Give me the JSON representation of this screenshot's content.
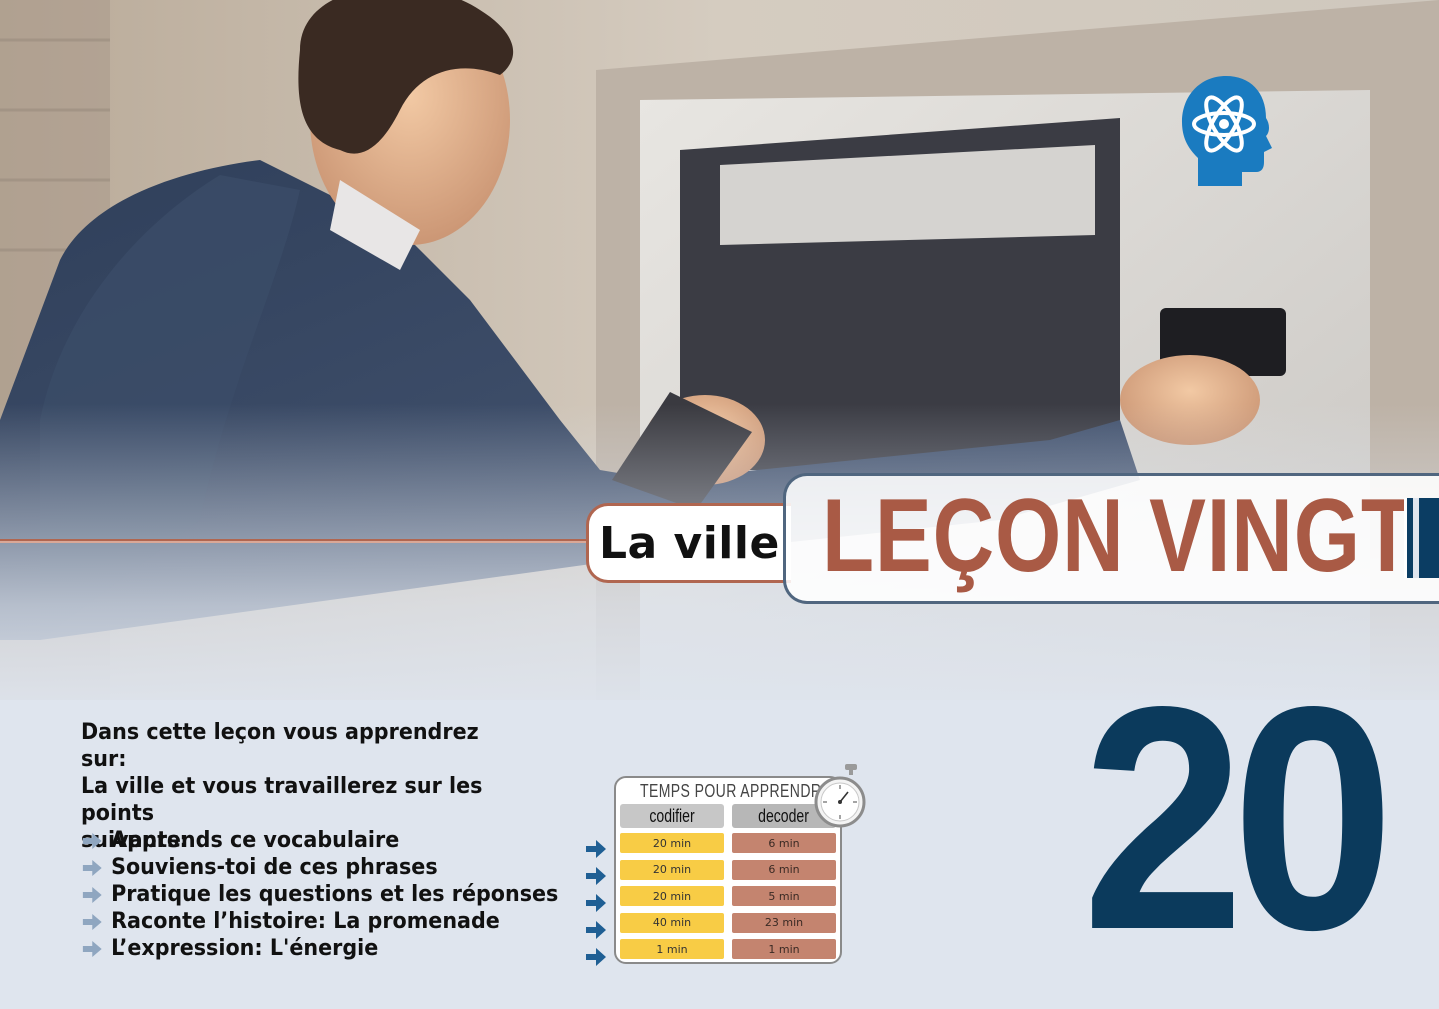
{
  "header": {
    "subtitle": "La ville",
    "title": "LEÇON VINGT"
  },
  "intro": {
    "line1": "Dans cette leçon vous apprendrez sur:",
    "line2": "La ville et vous travaillerez sur les points",
    "line3": "suivants:"
  },
  "topics": [
    "Apprends ce vocabulaire",
    "Souviens-toi de ces phrases",
    "Pratique les questions et les réponses",
    "Raconte l’histoire: La promenade",
    "L’expression: L'énergie"
  ],
  "time_table": {
    "title": "TEMPS POUR APPRENDRE",
    "codify_label": "codifier",
    "decode_label": "decoder",
    "rows": [
      {
        "codify": "20 min",
        "decode": "6 min"
      },
      {
        "codify": "20 min",
        "decode": "6 min"
      },
      {
        "codify": "20 min",
        "decode": "5 min"
      },
      {
        "codify": "40 min",
        "decode": "23 min"
      },
      {
        "codify": "1 min",
        "decode": "1 min"
      }
    ]
  },
  "lesson_number": "20",
  "colors": {
    "title_red": "#a95a45",
    "navy": "#0b3a5c",
    "arrow_blue": "#1f5f94",
    "codify_yellow": "#f8cc45",
    "decode_brown": "#c4846f",
    "logo_blue": "#1a7bc0"
  },
  "icons": {
    "logo": "brain-atom-head-icon",
    "bullet": "arrow-right-icon",
    "timer": "stopwatch-icon"
  }
}
